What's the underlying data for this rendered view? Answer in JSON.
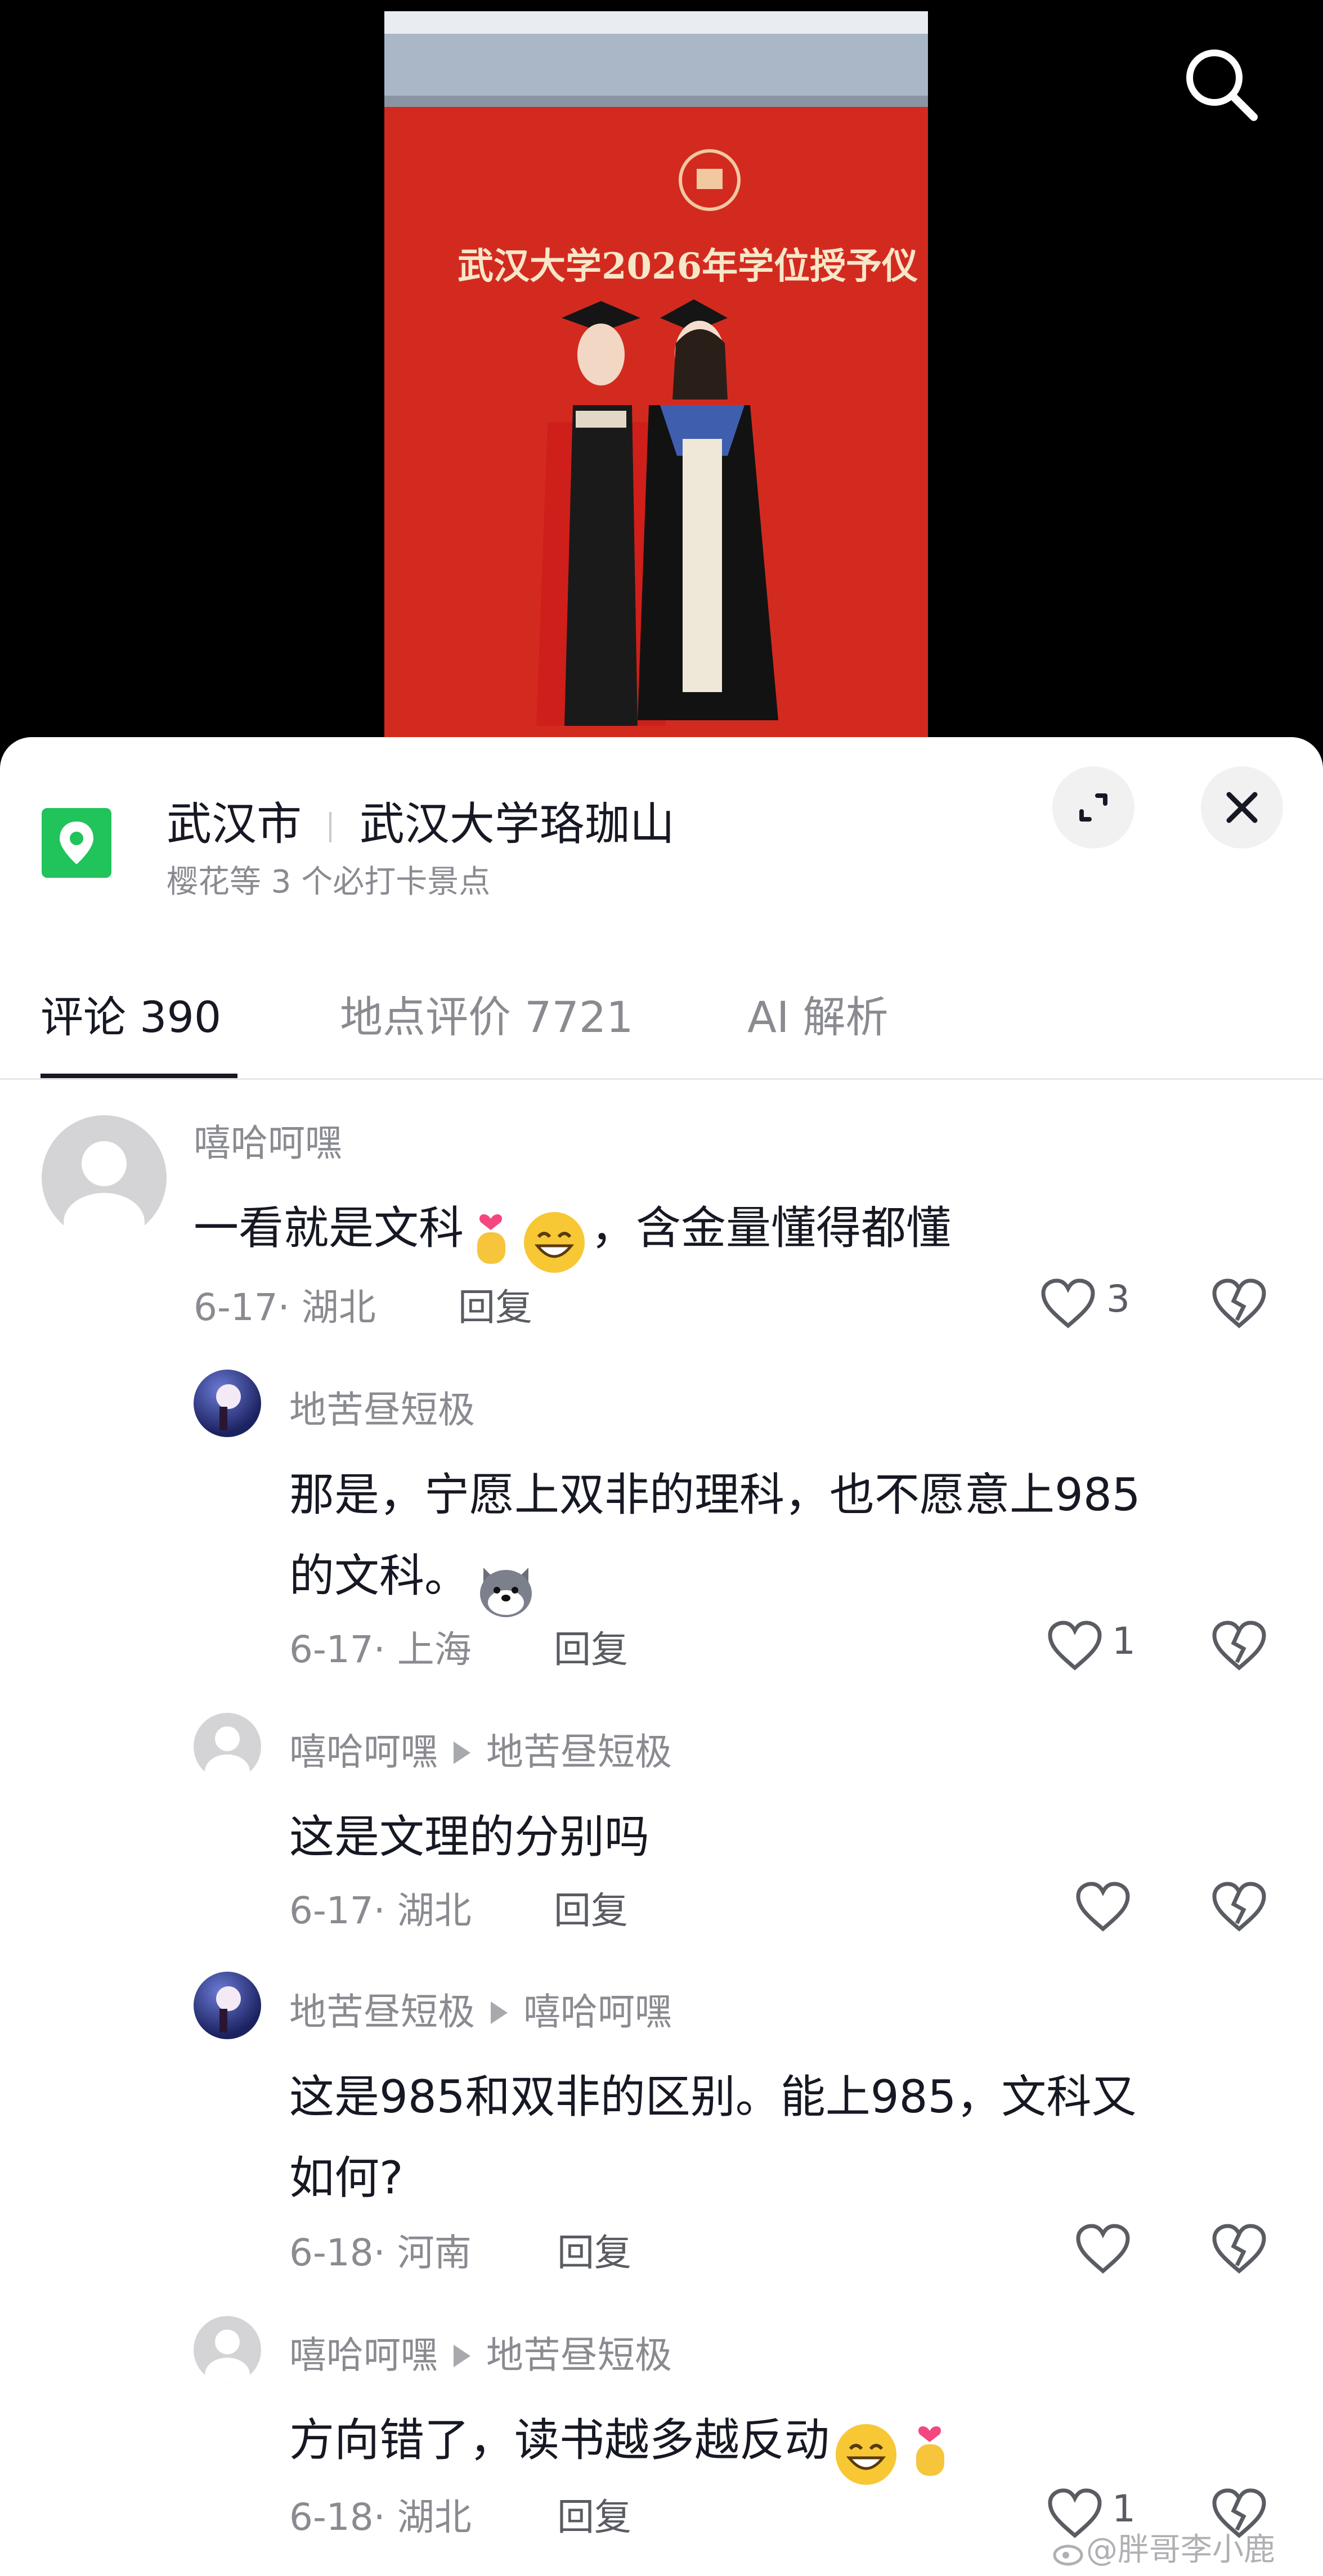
{
  "location": {
    "city": "武汉市",
    "place": "武汉大学珞珈山",
    "subtitle": "樱花等 3 个必打卡景点"
  },
  "photo": {
    "banner_text": "武汉大学2026年学位授予仪"
  },
  "tabs": [
    {
      "label": "评论 390",
      "active": true
    },
    {
      "label": "地点评价 7721",
      "active": false
    },
    {
      "label": "AI 解析",
      "active": false
    }
  ],
  "comments": [
    {
      "user": "嘻哈呵嘿",
      "text": "一看就是文科",
      "text_after": "，含金量懂得都懂",
      "meta": "6-17· 湖北",
      "reply": "回复",
      "likes": "3"
    },
    {
      "user": "地苦昼短极",
      "text_line1": "那是，宁愿上双非的理科，也不愿意上985",
      "text_line2": "的文科。",
      "meta": "6-17· 上海",
      "reply": "回复",
      "likes": "1"
    },
    {
      "user": "嘻哈呵嘿",
      "reply_to": "地苦昼短极",
      "text": "这是文理的分别吗",
      "meta": "6-17· 湖北",
      "reply": "回复"
    },
    {
      "user": "地苦昼短极",
      "reply_to": "嘻哈呵嘿",
      "text_line1": "这是985和双非的区别。能上985，文科又",
      "text_line2": "如何?",
      "meta": "6-18· 河南",
      "reply": "回复"
    },
    {
      "user": "嘻哈呵嘿",
      "reply_to": "地苦昼短极",
      "text": "方向错了，读书越多越反动",
      "meta": "6-18· 湖北",
      "reply": "回复",
      "likes": "1"
    }
  ],
  "watermark": "@胖哥李小鹿",
  "colors": {
    "location_pin": "#21c35b",
    "banner_red": "#d8241c",
    "text_primary": "#161823",
    "text_secondary": "#8a8b91"
  }
}
